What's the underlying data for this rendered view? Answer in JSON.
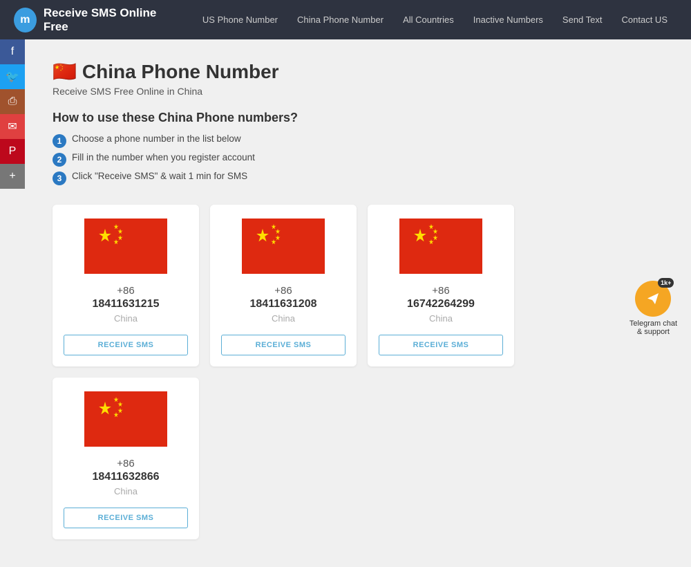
{
  "nav": {
    "logo_letter": "m",
    "logo_text": "Receive SMS Online Free",
    "links": [
      {
        "label": "US Phone Number",
        "href": "#"
      },
      {
        "label": "China Phone Number",
        "href": "#"
      },
      {
        "label": "All Countries",
        "href": "#"
      },
      {
        "label": "Inactive Numbers",
        "href": "#"
      },
      {
        "label": "Send Text",
        "href": "#"
      },
      {
        "label": "Contact US",
        "href": "#"
      }
    ]
  },
  "sidebar": {
    "buttons": [
      {
        "name": "facebook",
        "icon": "f",
        "class": "sb-facebook"
      },
      {
        "name": "twitter",
        "icon": "🐦",
        "class": "sb-twitter"
      },
      {
        "name": "print",
        "icon": "🖨",
        "class": "sb-print"
      },
      {
        "name": "email",
        "icon": "✉",
        "class": "sb-email"
      },
      {
        "name": "pinterest",
        "icon": "P",
        "class": "sb-pinterest"
      },
      {
        "name": "more",
        "icon": "+",
        "class": "sb-more"
      }
    ]
  },
  "page": {
    "title": "China Phone Number",
    "subtitle": "Receive SMS Free Online in China",
    "how_to_title": "How to use these China Phone numbers?",
    "steps": [
      "Choose a phone number in the list below",
      "Fill in the number when you register account",
      "Click \"Receive SMS\" & wait 1 min for SMS"
    ]
  },
  "cards": [
    {
      "code": "+86",
      "number": "18411631215",
      "country": "China"
    },
    {
      "code": "+86",
      "number": "18411631208",
      "country": "China"
    },
    {
      "code": "+86",
      "number": "16742264299",
      "country": "China"
    },
    {
      "code": "+86",
      "number": "18411632866",
      "country": "China"
    }
  ],
  "receive_btn_label": "RECEIVE SMS",
  "telegram": {
    "badge": "1k+",
    "label": "Telegram chat\n& support"
  }
}
